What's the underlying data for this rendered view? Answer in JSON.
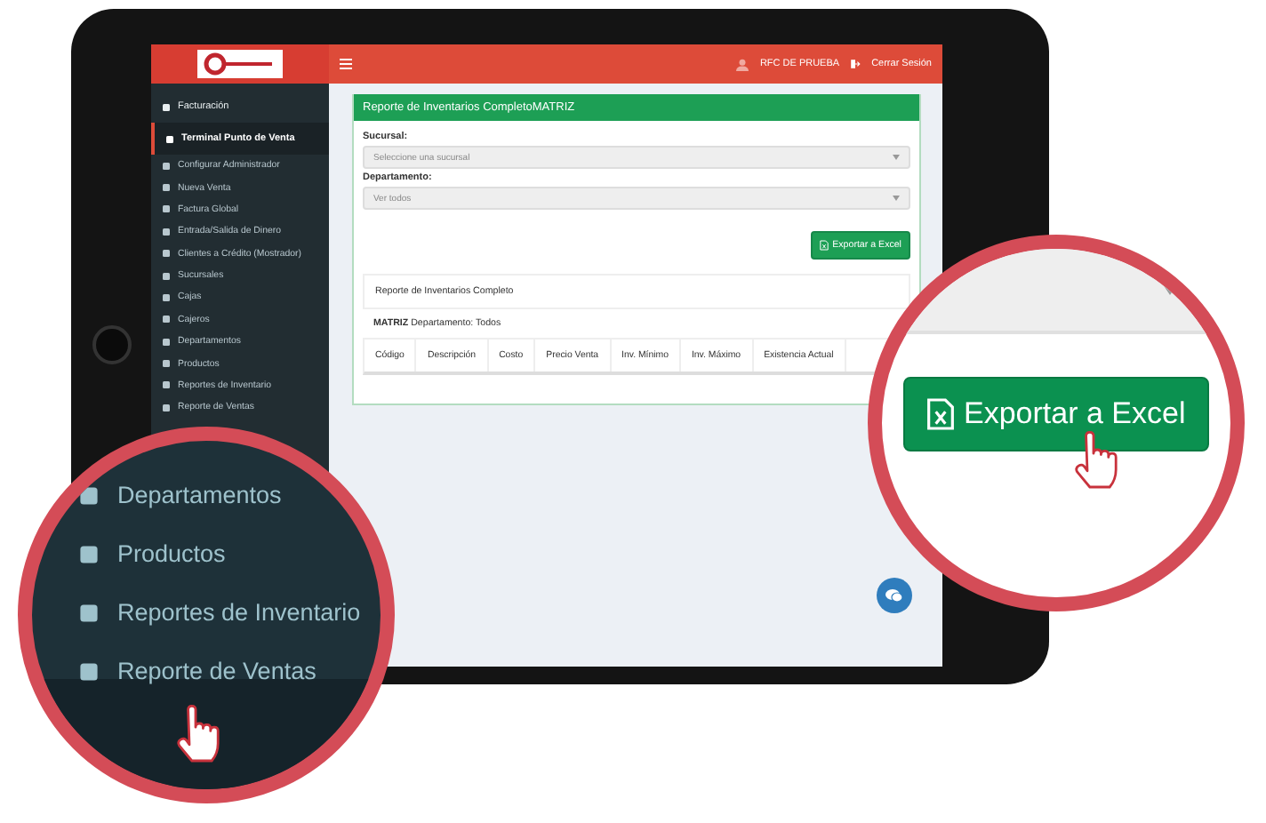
{
  "header": {
    "user": "RFC DE PRUEBA",
    "logout": "Cerrar Sesión"
  },
  "sidebar": {
    "items": [
      {
        "label": "Facturación",
        "kind": "section",
        "selected": false
      },
      {
        "label": "Terminal Punto de Venta",
        "kind": "section",
        "selected": true
      },
      {
        "label": "Configurar Administrador",
        "kind": "sub",
        "selected": false
      },
      {
        "label": "Nueva Venta",
        "kind": "sub",
        "selected": false
      },
      {
        "label": "Factura Global",
        "kind": "sub",
        "selected": false
      },
      {
        "label": "Entrada/Salida de Dinero",
        "kind": "sub",
        "selected": false
      },
      {
        "label": "Clientes a Crédito (Mostrador)",
        "kind": "sub",
        "selected": false
      },
      {
        "label": "Sucursales",
        "kind": "sub",
        "selected": false
      },
      {
        "label": "Cajas",
        "kind": "sub",
        "selected": false
      },
      {
        "label": "Cajeros",
        "kind": "sub",
        "selected": false
      },
      {
        "label": "Departamentos",
        "kind": "sub",
        "selected": false
      },
      {
        "label": "Productos",
        "kind": "sub",
        "selected": false
      },
      {
        "label": "Reportes de Inventario",
        "kind": "sub",
        "selected": false
      },
      {
        "label": "Reporte de Ventas",
        "kind": "sub",
        "selected": false
      }
    ]
  },
  "panel": {
    "title": "Reporte de Inventarios CompletoMATRIZ",
    "fields": [
      {
        "label": "Sucursal:",
        "placeholder": "Seleccione una sucursal"
      },
      {
        "label": "Departamento:",
        "value": "Ver todos"
      }
    ],
    "export_button": "Exportar a Excel",
    "report_title": "Reporte de Inventarios Completo",
    "report_subtitle": "**MATRIZ** Departamento: Todos",
    "table": {
      "columns": [
        "Código",
        "Descripción",
        "Costo",
        "Precio Venta",
        "Inv. Mínimo",
        "Inv. Máximo",
        "Existencia Actual"
      ]
    }
  },
  "zoom_left": {
    "items": [
      "Departamentos",
      "Productos",
      "Reportes de Inventario",
      "Reporte de Ventas"
    ]
  },
  "zoom_right": {
    "button": "Exportar a Excel"
  }
}
